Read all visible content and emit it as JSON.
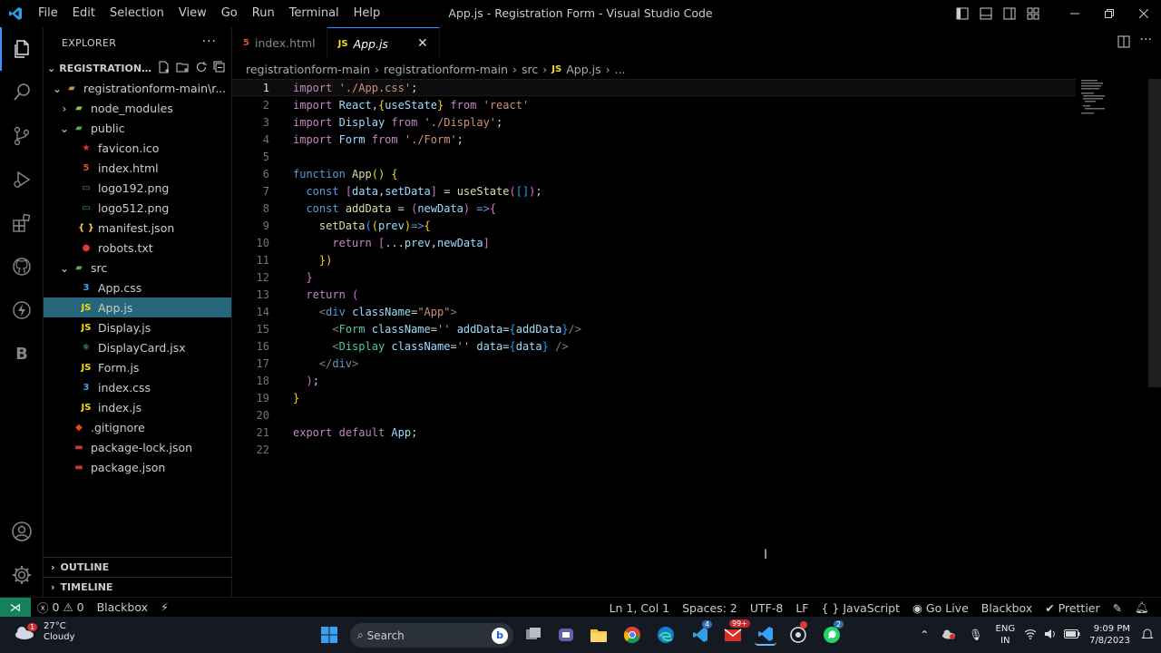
{
  "window": {
    "title": "App.js - Registration Form - Visual Studio Code",
    "menu": [
      "File",
      "Edit",
      "Selection",
      "View",
      "Go",
      "Run",
      "Terminal",
      "Help"
    ]
  },
  "activity_icons": [
    "explorer-icon",
    "search-icon",
    "source-control-icon",
    "run-debug-icon",
    "extensions-icon",
    "github-icon",
    "lightning-icon",
    "blackbox-icon",
    "account-icon",
    "settings-gear-icon"
  ],
  "sidebar": {
    "header": "EXPLORER",
    "more": "···",
    "root_label": "REGISTRATION...",
    "tree": [
      {
        "label": "registrationform-main\\r...",
        "depth": 1,
        "chev": "⌄",
        "icon": "folder-icon",
        "iconText": "▰",
        "color": "#c09553"
      },
      {
        "label": "node_modules",
        "depth": 2,
        "chev": "›",
        "icon": "folder-green-icon",
        "iconText": "▰",
        "color": "#8bc34a"
      },
      {
        "label": "public",
        "depth": 2,
        "chev": "⌄",
        "icon": "folder-green-icon",
        "iconText": "▰",
        "color": "#4caf50"
      },
      {
        "label": "favicon.ico",
        "depth": 3,
        "chev": "",
        "icon": "star-icon",
        "iconText": "★",
        "color": "#e53935"
      },
      {
        "label": "index.html",
        "depth": 3,
        "chev": "",
        "icon": "html5-icon",
        "iconText": "5",
        "color": "#e44d26"
      },
      {
        "label": "logo192.png",
        "depth": 3,
        "chev": "",
        "icon": "image-icon",
        "iconText": "▭",
        "color": "#26a69a"
      },
      {
        "label": "logo512.png",
        "depth": 3,
        "chev": "",
        "icon": "image-icon",
        "iconText": "▭",
        "color": "#26a69a"
      },
      {
        "label": "manifest.json",
        "depth": 3,
        "chev": "",
        "icon": "json-braces-icon",
        "iconText": "{ }",
        "color": "#f9c74f"
      },
      {
        "label": "robots.txt",
        "depth": 3,
        "chev": "",
        "icon": "robot-icon",
        "iconText": "●",
        "color": "#e53935"
      },
      {
        "label": "src",
        "depth": 2,
        "chev": "⌄",
        "icon": "folder-green-icon",
        "iconText": "▰",
        "color": "#4caf50"
      },
      {
        "label": "App.css",
        "depth": 3,
        "chev": "",
        "icon": "css3-icon",
        "iconText": "3",
        "color": "#42a5f5"
      },
      {
        "label": "App.js",
        "depth": 3,
        "chev": "",
        "icon": "js-icon",
        "iconText": "JS",
        "color": "#f5de19",
        "selected": true
      },
      {
        "label": "Display.js",
        "depth": 3,
        "chev": "",
        "icon": "js-icon",
        "iconText": "JS",
        "color": "#f5de19"
      },
      {
        "label": "DisplayCard.jsx",
        "depth": 3,
        "chev": "",
        "icon": "react-icon",
        "iconText": "⚛",
        "color": "#61dafb"
      },
      {
        "label": "Form.js",
        "depth": 3,
        "chev": "",
        "icon": "js-icon",
        "iconText": "JS",
        "color": "#f5de19"
      },
      {
        "label": "index.css",
        "depth": 3,
        "chev": "",
        "icon": "css3-icon",
        "iconText": "3",
        "color": "#42a5f5"
      },
      {
        "label": "index.js",
        "depth": 3,
        "chev": "",
        "icon": "js-icon",
        "iconText": "JS",
        "color": "#f5de19"
      },
      {
        "label": ".gitignore",
        "depth": 2,
        "chev": "",
        "icon": "git-icon",
        "iconText": "◆",
        "color": "#e64a19"
      },
      {
        "label": "package-lock.json",
        "depth": 2,
        "chev": "",
        "icon": "npm-icon",
        "iconText": "▬",
        "color": "#cb3837"
      },
      {
        "label": "package.json",
        "depth": 2,
        "chev": "",
        "icon": "npm-icon",
        "iconText": "▬",
        "color": "#cb3837"
      }
    ],
    "outline": "OUTLINE",
    "timeline": "TIMELINE"
  },
  "tabs": [
    {
      "label": "index.html",
      "icon": "html5-icon",
      "iconText": "5",
      "color": "#e44d26",
      "active": false
    },
    {
      "label": "App.js",
      "icon": "js-icon",
      "iconText": "JS",
      "color": "#f5de19",
      "active": true
    }
  ],
  "breadcrumb": [
    "registrationform-main",
    "registrationform-main",
    "src",
    "App.js",
    "..."
  ],
  "code_lines": [
    "<span class='k'>import</span> <span class='s'>'./App.css'</span>;",
    "<span class='k'>import</span> <span class='v'>React</span>,<span class='p1'>{</span><span class='v'>useState</span><span class='p1'>}</span> <span class='k'>from</span> <span class='s'>'react'</span>",
    "<span class='k'>import</span> <span class='v'>Display</span> <span class='k'>from</span> <span class='s'>'./Display'</span>;",
    "<span class='k'>import</span> <span class='v'>Form</span> <span class='k'>from</span> <span class='s'>'./Form'</span>;",
    "",
    "<span class='kb'>function</span> <span class='f'>App</span><span class='p1'>()</span> <span class='p1'>{</span>",
    "  <span class='kb'>const</span> <span class='p2'>[</span><span class='v'>data</span>,<span class='v'>setData</span><span class='p2'>]</span> = <span class='f'>useState</span><span class='p2'>(</span><span class='p3'>[]</span><span class='p2'>)</span>;",
    "  <span class='kb'>const</span> <span class='f'>addData</span> = <span class='p2'>(</span><span class='v'>newData</span><span class='p2'>)</span> <span class='kb'>=&gt;</span><span class='p2'>{</span>",
    "    <span class='f'>setData</span><span class='p3'>(</span><span class='p1'>(</span><span class='v'>prev</span><span class='p1'>)</span><span class='kb'>=&gt;</span><span class='p1'>{</span>",
    "      <span class='k'>return</span> <span class='p2'>[</span>...<span class='v'>prev</span>,<span class='v'>newData</span><span class='p2'>]</span>",
    "    <span class='p1'>})</span>",
    "  <span class='p2'>}</span>",
    "  <span class='k'>return</span> <span class='p2'>(</span>",
    "    <span class='pu'>&lt;</span><span class='tg'>div</span> <span class='v'>className</span>=<span class='s'>\"App\"</span><span class='pu'>&gt;</span>",
    "      <span class='pu'>&lt;</span><span class='t'>Form</span> <span class='v'>className</span>=<span class='s'>''</span> <span class='v'>addData</span>=<span class='p3'>{</span><span class='v'>addData</span><span class='p3'>}</span><span class='pu'>/&gt;</span>",
    "      <span class='pu'>&lt;</span><span class='t'>Display</span> <span class='v'>className</span>=<span class='s'>''</span> <span class='v'>data</span>=<span class='p3'>{</span><span class='v'>data</span><span class='p3'>}</span> <span class='pu'>/&gt;</span>",
    "    <span class='pu'>&lt;/</span><span class='tg'>div</span><span class='pu'>&gt;</span>",
    "  <span class='p2'>)</span>;",
    "<span class='p1'>}</span>",
    "",
    "<span class='k'>export</span> <span class='k'>default</span> <span class='v'>App</span>;",
    ""
  ],
  "status": {
    "errors": "0",
    "warnings": "0",
    "blackbox": "Blackbox",
    "position": "Ln 1, Col 1",
    "spaces": "Spaces: 2",
    "encoding": "UTF-8",
    "eol": "LF",
    "language": "JavaScript",
    "golive": "Go Live",
    "blackbox2": "Blackbox",
    "prettier": "Prettier"
  },
  "taskbar": {
    "temp": "27°C",
    "weather": "Cloudy",
    "weather_badge": "1",
    "search_placeholder": "Search",
    "lang": "ENG",
    "region": "IN",
    "time": "9:09 PM",
    "date": "7/8/2023",
    "badge_4": "4",
    "badge_99": "99+",
    "badge_2": "2"
  }
}
